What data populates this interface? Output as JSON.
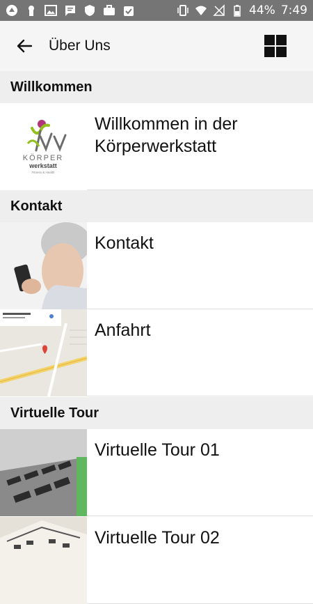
{
  "statusbar": {
    "battery": "44%",
    "time": "7:49"
  },
  "appbar": {
    "title": "Über Uns"
  },
  "sections": [
    {
      "title": "Willkommen"
    },
    {
      "title": "Kontakt"
    },
    {
      "title": "Virtuelle Tour"
    }
  ],
  "items": [
    {
      "label": "Willkommen in der Körperwerkstatt",
      "thumb": "koerperwerkstatt-logo"
    },
    {
      "label": "Kontakt",
      "thumb": "hand-holding-phone"
    },
    {
      "label": "Anfahrt",
      "thumb": "map"
    },
    {
      "label": "Virtuelle Tour 01",
      "thumb": "gym-render"
    },
    {
      "label": "Virtuelle Tour 02",
      "thumb": "gym-floorplan"
    }
  ],
  "logo": {
    "name": "KÖRPER",
    "sub": "werkstatt",
    "tagline": "Fitness & Health"
  }
}
